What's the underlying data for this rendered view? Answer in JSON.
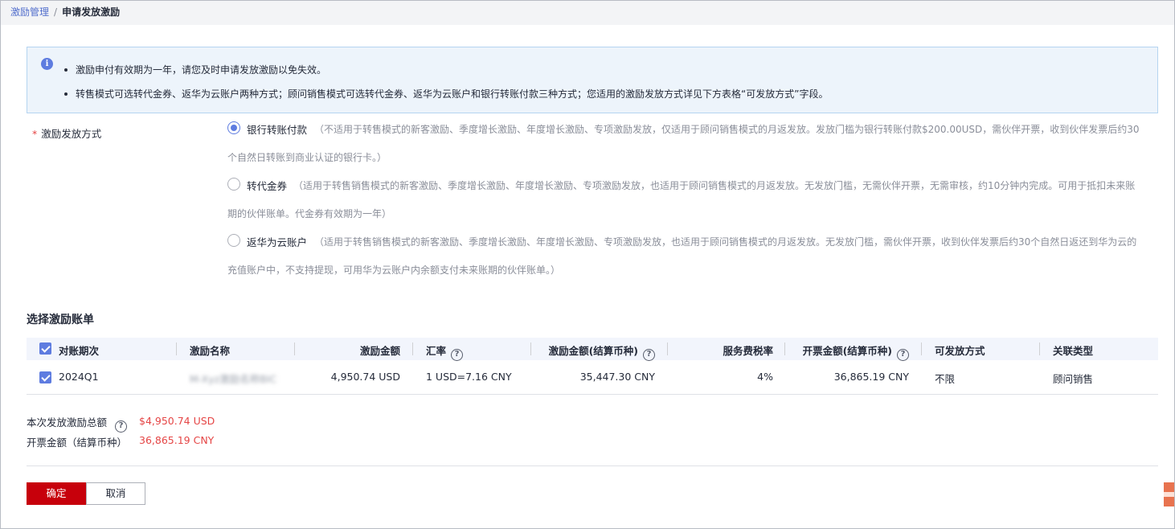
{
  "breadcrumb": {
    "parent": "激励管理",
    "separator": "/",
    "current": "申请发放激励"
  },
  "notice": {
    "icon": "info-icon",
    "items": [
      "激励申付有效期为一年，请您及时申请发放激励以免失效。",
      "转售模式可选转代金券、返华为云账户两种方式；顾问销售模式可选转代金券、返华为云账户和银行转账付款三种方式；您适用的激励发放方式详见下方表格“可发放方式”字段。"
    ]
  },
  "form": {
    "required_mark": "*",
    "label": "激励发放方式",
    "options": [
      {
        "label": "银行转账付款",
        "selected": true,
        "desc_line1": "（不适用于转售模式的新客激励、季度增长激励、年度增长激励、专项激励发放，仅适用于顾问销售模式的月返发放。发放门槛为银行转账付款$200.00USD，需伙伴开票，收到伙伴发票后约30",
        "desc_line2": "个自然日转账到商业认证的银行卡。）"
      },
      {
        "label": "转代金券",
        "selected": false,
        "desc_line1": "（适用于转售销售模式的新客激励、季度增长激励、年度增长激励、专项激励发放，也适用于顾问销售模式的月返发放。无发放门槛，无需伙伴开票，无需审核，约10分钟内完成。可用于抵扣未来账",
        "desc_line2": "期的伙伴账单。代金券有效期为一年）"
      },
      {
        "label": "返华为云账户",
        "selected": false,
        "desc_line1": "（适用于转售销售模式的新客激励、季度增长激励、年度增长激励、专项激励发放，也适用于顾问销售模式的月返发放。无发放门槛，需伙伴开票，收到伙伴发票后约30个自然日返还到华为云的",
        "desc_line2": "充值账户中，不支持提现，可用华为云账户内余额支付未来账期的伙伴账单。）"
      }
    ]
  },
  "table": {
    "section_title": "选择激励账单",
    "headers": {
      "period": "对账期次",
      "name": "激励名称",
      "amount": "激励金额",
      "rate": "汇率",
      "settle_amount": "激励金额(结算币种)",
      "tax_rate": "服务费税率",
      "invoice_amount": "开票金额(结算币种)",
      "method": "可发放方式",
      "type": "关联类型"
    },
    "rows": [
      {
        "period": "2024Q1",
        "name": "M-Xyz激励名称BIC",
        "amount": "4,950.74 USD",
        "rate": "1 USD=7.16 CNY",
        "settle_amount": "35,447.30 CNY",
        "tax_rate": "4%",
        "invoice_amount": "36,865.19 CNY",
        "method": "不限",
        "type": "顾问销售"
      }
    ]
  },
  "summary": {
    "total_label": "本次发放激励总额",
    "total_value": "$4,950.74 USD",
    "invoice_label": "开票金额（结算币种）",
    "invoice_value": "36,865.19 CNY"
  },
  "actions": {
    "confirm": "确定",
    "cancel": "取消"
  },
  "colors": {
    "primary": "#c7000b",
    "link": "#526ecc",
    "radio_checked": "#5e7ce0",
    "amount_red": "#e54545"
  }
}
